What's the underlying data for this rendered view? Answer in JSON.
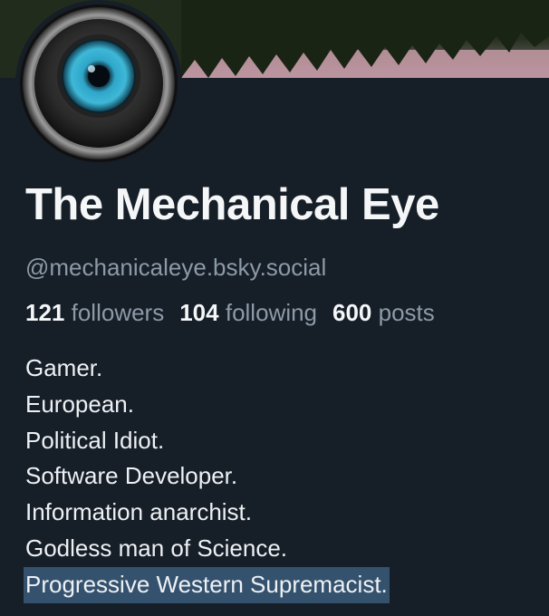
{
  "profile": {
    "display_name": "The Mechanical Eye",
    "handle": "@mechanicaleye.bsky.social",
    "stats": {
      "followers_count": "121",
      "followers_label": "followers",
      "following_count": "104",
      "following_label": "following",
      "posts_count": "600",
      "posts_label": "posts"
    },
    "bio": [
      "Gamer.",
      "European.",
      "Political Idiot.",
      "Software Developer.",
      "Information anarchist.",
      "Godless man of Science.",
      "Progressive Western Supremacist."
    ],
    "selected_bio_line": 6
  },
  "colors": {
    "background": "#161e27",
    "muted_text": "#8c9aa8",
    "selection": "#34526e",
    "eye_iris": "#3fb8d8"
  },
  "icons": {
    "avatar": "mechanical-eye-icon",
    "banner": "forest-lake-reflection"
  }
}
